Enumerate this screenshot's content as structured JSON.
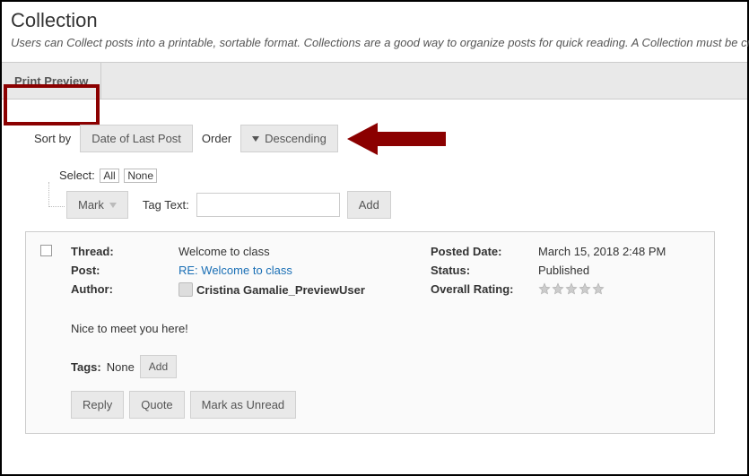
{
  "header": {
    "title": "Collection",
    "subtitle": "Users can Collect posts into a printable, sortable format. Collections are a good way to organize posts for quick reading. A Collection must be create"
  },
  "tabs": {
    "print_preview": "Print Preview"
  },
  "sort": {
    "sort_by_label": "Sort by",
    "sort_by_value": "Date of Last Post",
    "order_label": "Order",
    "order_value": "Descending"
  },
  "select": {
    "label": "Select:",
    "all": "All",
    "none": "None"
  },
  "actions": {
    "mark": "Mark",
    "tag_label": "Tag Text:",
    "tag_value": "",
    "add": "Add"
  },
  "post": {
    "thread_label": "Thread:",
    "thread_value": "Welcome to class",
    "post_label": "Post:",
    "post_value": "RE: Welcome to class",
    "author_label": "Author:",
    "author_value": "Cristina Gamalie_PreviewUser",
    "date_label": "Posted Date:",
    "date_value": "March 15, 2018 2:48 PM",
    "status_label": "Status:",
    "status_value": "Published",
    "rating_label": "Overall Rating:",
    "body": "Nice to meet you here!",
    "tags_label": "Tags:",
    "tags_value": "None",
    "tags_add": "Add",
    "reply": "Reply",
    "quote": "Quote",
    "mark_unread": "Mark as Unread"
  }
}
